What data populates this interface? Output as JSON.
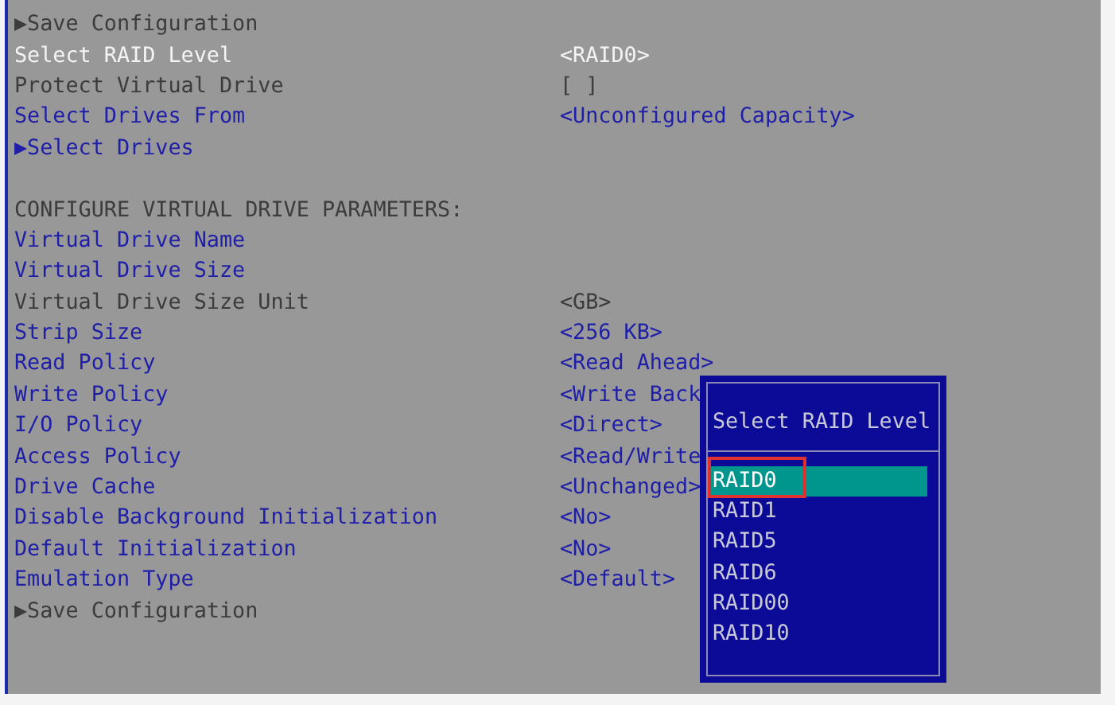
{
  "rows": [
    {
      "kind": "submenu",
      "label": "▶Save Configuration",
      "selected": false,
      "disabled": true
    },
    {
      "kind": "field",
      "label": "Select RAID Level",
      "value": "<RAID0>",
      "selected": true,
      "disabled": false
    },
    {
      "kind": "field",
      "label": "Protect Virtual Drive",
      "value": "[ ]",
      "selected": false,
      "disabled": true
    },
    {
      "kind": "field",
      "label": "Select Drives From",
      "value": "<Unconfigured Capacity>",
      "selected": false,
      "disabled": false
    },
    {
      "kind": "submenu",
      "label": "▶Select Drives",
      "selected": false,
      "disabled": false
    },
    {
      "kind": "heading",
      "label": "CONFIGURE VIRTUAL DRIVE PARAMETERS:",
      "selected": false,
      "disabled": true
    },
    {
      "kind": "field",
      "label": "Virtual Drive Name",
      "selected": false,
      "disabled": false
    },
    {
      "kind": "field",
      "label": "Virtual Drive Size",
      "selected": false,
      "disabled": false
    },
    {
      "kind": "field",
      "label": "Virtual Drive Size Unit",
      "value": "<GB>",
      "selected": false,
      "disabled": true
    },
    {
      "kind": "field",
      "label": "Strip Size",
      "value": "<256 KB>",
      "selected": false,
      "disabled": false
    },
    {
      "kind": "field",
      "label": "Read Policy",
      "value": "<Read Ahead>",
      "selected": false,
      "disabled": false
    },
    {
      "kind": "field",
      "label": "Write Policy",
      "value": "<Write Back",
      "selected": false,
      "disabled": false
    },
    {
      "kind": "field",
      "label": "I/O Policy",
      "value": "<Direct>",
      "selected": false,
      "disabled": false
    },
    {
      "kind": "field",
      "label": "Access Policy",
      "value": "<Read/Write",
      "selected": false,
      "disabled": false
    },
    {
      "kind": "field",
      "label": "Drive Cache",
      "value": "<Unchanged>",
      "selected": false,
      "disabled": false
    },
    {
      "kind": "field",
      "label": "Disable Background Initialization",
      "value": "<No>",
      "selected": false,
      "disabled": false
    },
    {
      "kind": "field",
      "label": "Default Initialization",
      "value": "<No>",
      "selected": false,
      "disabled": false
    },
    {
      "kind": "field",
      "label": "Emulation Type",
      "value": "<Default>",
      "selected": false,
      "disabled": false
    },
    {
      "kind": "submenu",
      "label": "▶Save Configuration",
      "selected": false,
      "disabled": true
    }
  ],
  "popup": {
    "title": "Select RAID Level",
    "options": [
      {
        "label": "RAID0",
        "selected": true,
        "highlighted": true
      },
      {
        "label": "RAID1",
        "selected": false,
        "highlighted": false
      },
      {
        "label": "RAID5",
        "selected": false,
        "highlighted": false
      },
      {
        "label": "RAID6",
        "selected": false,
        "highlighted": false
      },
      {
        "label": "RAID00",
        "selected": false,
        "highlighted": false
      },
      {
        "label": "RAID10",
        "selected": false,
        "highlighted": false
      }
    ]
  }
}
